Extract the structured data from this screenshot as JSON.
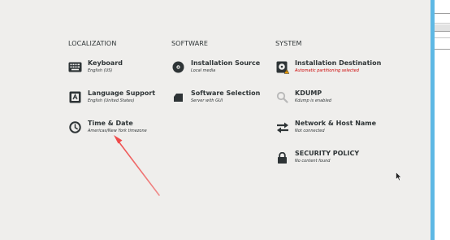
{
  "colors": {
    "background": "#efeeec",
    "text": "#2e3436",
    "warning": "#cc0000",
    "accent_strip": "#5eb8e4",
    "annotation_arrow": "#ef4a4a"
  },
  "localization": {
    "heading": "LOCALIZATION",
    "items": [
      {
        "icon": "keyboard-icon",
        "title": "Keyboard",
        "status": "English (US)"
      },
      {
        "icon": "language-icon",
        "title": "Language Support",
        "status": "English (United States)"
      },
      {
        "icon": "clock-icon",
        "title": "Time & Date",
        "status": "Americas/New York timezone"
      }
    ]
  },
  "software": {
    "heading": "SOFTWARE",
    "items": [
      {
        "icon": "disc-icon",
        "title": "Installation Source",
        "status": "Local media"
      },
      {
        "icon": "package-icon",
        "title": "Software Selection",
        "status": "Server with GUI"
      }
    ]
  },
  "system": {
    "heading": "SYSTEM",
    "items": [
      {
        "icon": "hard-drive-warning-icon",
        "title": "Installation Destination",
        "status": "Automatic partitioning selected",
        "warning": true
      },
      {
        "icon": "search-icon",
        "title": "KDUMP",
        "status": "Kdump is enabled"
      },
      {
        "icon": "network-arrows-icon",
        "title": "Network & Host Name",
        "status": "Not connected"
      },
      {
        "icon": "lock-icon",
        "title": "SECURITY POLICY",
        "status": "No content found"
      }
    ]
  }
}
